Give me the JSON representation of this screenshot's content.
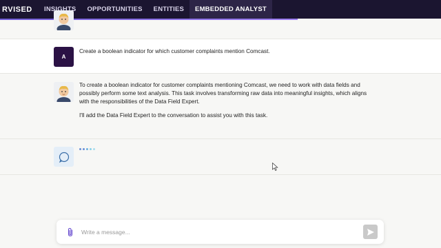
{
  "nav": {
    "brand": "RVISED",
    "tabs": [
      {
        "label": "INSIGHTS"
      },
      {
        "label": "OPPORTUNITIES"
      },
      {
        "label": "ENTITIES"
      },
      {
        "label": "EMBEDDED ANALYST"
      }
    ]
  },
  "messages": {
    "user": {
      "avatar_letter": "A",
      "text": "Create a boolean indicator for which customer complaints mention Comcast."
    },
    "assistant": {
      "p1": "To create a boolean indicator for customer complaints mentioning Comcast, we need to work with data fields and possibly perform some text analysis. This task involves transforming raw data into meaningful insights, which aligns with the responsibilities of the Data Field Expert.",
      "p2": "I'll add the Data Field Expert to the conversation to assist you with this task."
    }
  },
  "composer": {
    "placeholder": "Write a message..."
  },
  "colors": {
    "nav_bg": "#1b1530",
    "accent": "#6f5bd6",
    "user_avatar": "#2b1245",
    "thinking_dots": [
      "#6a8fd8",
      "#6a8fd8",
      "#6ab0e0",
      "#8ad0e8",
      "#a8ddee"
    ]
  },
  "icons": [
    "user-avatar-icon",
    "assistant-avatar-icon",
    "thinking-bubble-icon",
    "paperclip-icon",
    "send-icon",
    "mouse-cursor-icon"
  ]
}
